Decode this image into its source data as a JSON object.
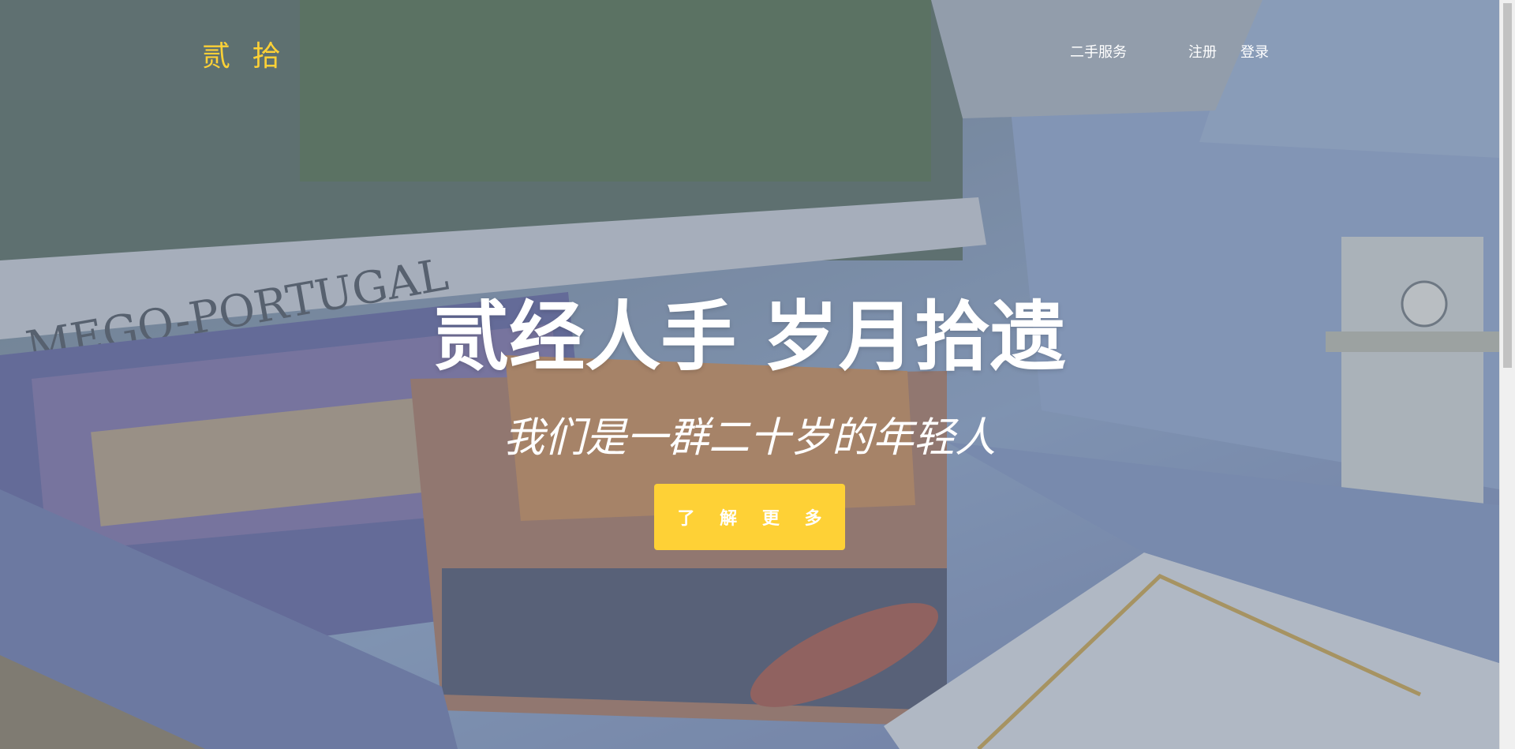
{
  "navbar": {
    "brand": "贰 拾",
    "links": {
      "services": "二手服务",
      "register": "注册",
      "login": "登录"
    }
  },
  "hero": {
    "heading": "贰经人手 岁月拾遗",
    "subheading": "我们是一群二十岁的年轻人",
    "button_label": "了 解 更 多",
    "background_text": "MEGO-PORTUGAL"
  },
  "colors": {
    "accent": "#fed136",
    "text": "#ffffff"
  }
}
